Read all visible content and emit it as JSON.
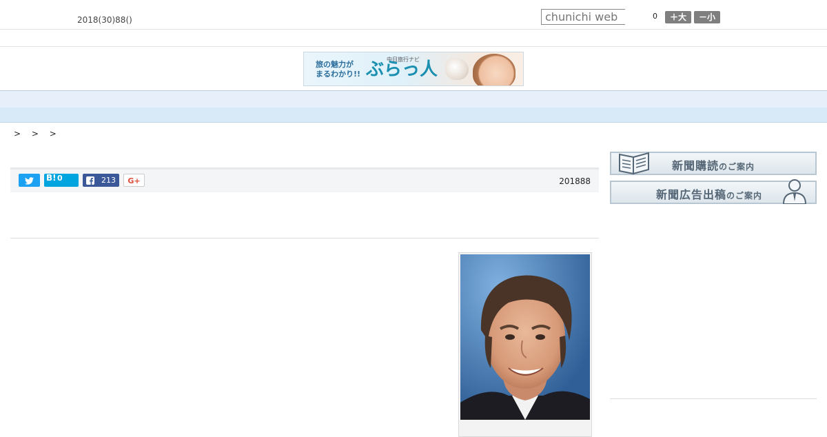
{
  "header": {
    "date": "2018(30)88()",
    "search_placeholder": "chunichi web",
    "font_count": "0",
    "font_up_label": "＋大",
    "font_down_label": "－小"
  },
  "banner": {
    "copy_line1": "旅の魅力が",
    "copy_line2": "まるわかり!!",
    "small_text": "中日旅行ナビ",
    "logo": "ぶらっ人"
  },
  "nav": {
    "items": [
      "",
      "",
      "",
      "",
      "",
      "",
      "",
      "",
      ""
    ]
  },
  "breadcrumb": ">  >  >",
  "share": {
    "twitter_icon": "twitter-bird-icon",
    "hatena_label": "B!",
    "hatena_count": "0",
    "facebook_count": "213",
    "gplus_label": "G+"
  },
  "article": {
    "published_date": "201888"
  },
  "sidebar": {
    "subscribe_main": "新聞購読",
    "subscribe_suffix": "のご案内",
    "ad_main": "新聞広告出稿",
    "ad_suffix": "のご案内"
  },
  "colors": {
    "nav_bg": "#e7f0fa",
    "subnav_bg": "#d8e9f7",
    "twitter": "#1da1f2",
    "hatena": "#00a4de",
    "facebook": "#3b5998",
    "gplus": "#dd4b39"
  }
}
